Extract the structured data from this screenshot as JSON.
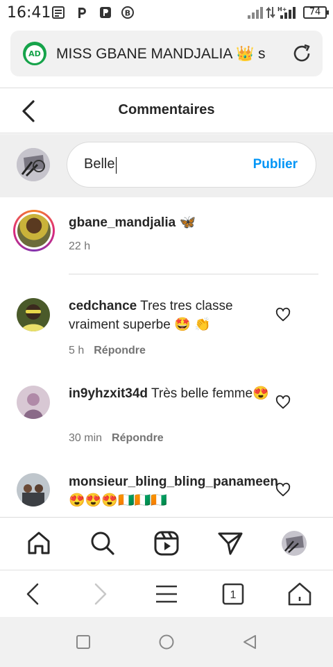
{
  "status_bar": {
    "time": "16:41",
    "battery": "74",
    "notification_icons": [
      "news-icon",
      "p-app-icon",
      "parking-app-icon",
      "bitcoin-icon"
    ]
  },
  "browser": {
    "page_title": "MISS GBANE MANDJALIA 👑 s",
    "ad_badge": "AD",
    "tabs_count": "1"
  },
  "header": {
    "title": "Commentaires"
  },
  "composer": {
    "value": "Belle",
    "publish_label": "Publier"
  },
  "caption": {
    "username": "gbane_mandjalia",
    "text": "🦋",
    "time": "22 h"
  },
  "comments": [
    {
      "username": "cedchance",
      "text": "Tres tres classe vraiment superbe 🤩 👏",
      "time": "5 h",
      "reply_label": "Répondre"
    },
    {
      "username": "in9yhzxit34d",
      "text": "Très belle femme😍",
      "time": "30 min",
      "reply_label": "Répondre"
    },
    {
      "username": "monsieur_bling_bling_panameen",
      "text": "😍😍😍🇨🇮🇨🇮🇨🇮",
      "time": "",
      "reply_label": ""
    }
  ],
  "colors": {
    "accent": "#0095f6",
    "meta": "#737373",
    "text": "#262626"
  }
}
